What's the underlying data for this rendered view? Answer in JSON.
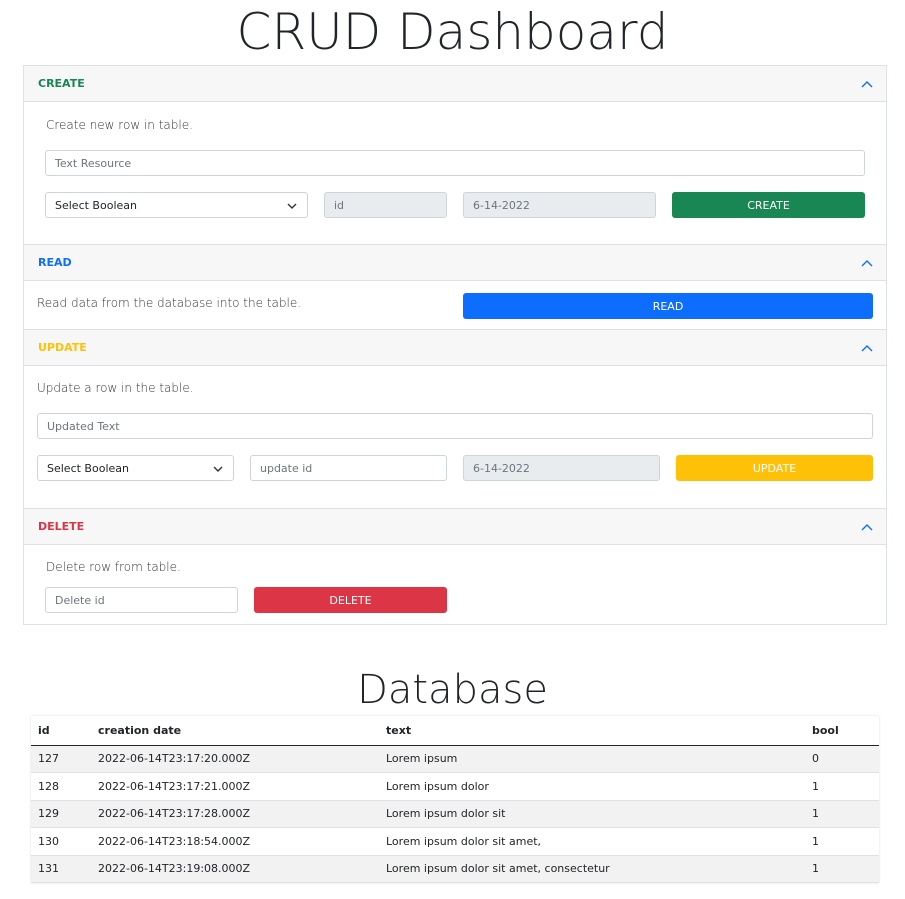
{
  "title": "CRUD Dashboard",
  "colors": {
    "create": "#198754",
    "read": "#0d6efd",
    "update": "#ffc107",
    "delete": "#dc3545"
  },
  "create": {
    "header": "CREATE",
    "description": "Create new row in table.",
    "text_placeholder": "Text Resource",
    "select_value": "Select Boolean",
    "id_placeholder": "id",
    "date_value": "6-14-2022",
    "button": "CREATE"
  },
  "read": {
    "header": "READ",
    "description": "Read data from the database into the table.",
    "button": "READ"
  },
  "update": {
    "header": "UPDATE",
    "description": "Update a row in the table.",
    "text_placeholder": "Updated Text",
    "select_value": "Select Boolean",
    "id_placeholder": "update id",
    "date_value": "6-14-2022",
    "button": "UPDATE"
  },
  "delete": {
    "header": "DELETE",
    "description": "Delete row from table.",
    "id_placeholder": "Delete id",
    "button": "DELETE"
  },
  "database": {
    "title": "Database",
    "columns": [
      "id",
      "creation date",
      "text",
      "bool"
    ],
    "rows": [
      [
        "127",
        "2022-06-14T23:17:20.000Z",
        "Lorem ipsum",
        "0"
      ],
      [
        "128",
        "2022-06-14T23:17:21.000Z",
        "Lorem ipsum dolor",
        "1"
      ],
      [
        "129",
        "2022-06-14T23:17:28.000Z",
        "Lorem ipsum dolor sit",
        "1"
      ],
      [
        "130",
        "2022-06-14T23:18:54.000Z",
        "Lorem ipsum dolor sit amet,",
        "1"
      ],
      [
        "131",
        "2022-06-14T23:19:08.000Z",
        "Lorem ipsum dolor sit amet, consectetur",
        "1"
      ]
    ]
  }
}
